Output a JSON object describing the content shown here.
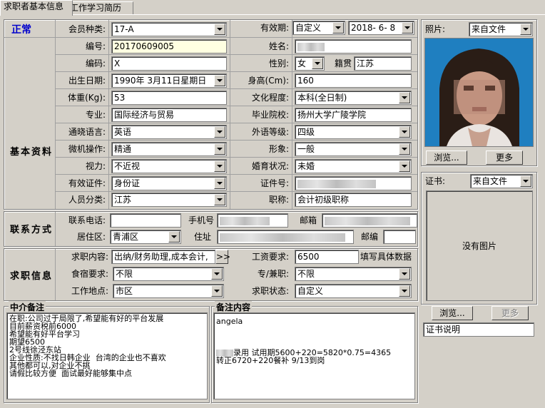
{
  "tabs": [
    "求职者基本信息",
    "工作学习简历"
  ],
  "status": "正常",
  "sections": {
    "basic": "基本资料",
    "contact": "联系方式",
    "job": "求职信息",
    "agent_notes": "中介备注",
    "notes": "备注内容"
  },
  "labels": {
    "member_type": "会员种类:",
    "validity": "有效期:",
    "number": "编号:",
    "name": "姓名:",
    "code": "编码:",
    "gender": "性别:",
    "native": "籍贯",
    "birth": "出生日期:",
    "height": "身高(Cm):",
    "weight": "体重(Kg):",
    "education": "文化程度:",
    "major": "专业:",
    "school": "毕业院校:",
    "language": "通晓语言:",
    "foreign_level": "外语等级:",
    "computer": "微机操作:",
    "image": "形象:",
    "vision": "视力:",
    "marital": "婚育状况:",
    "id_type": "有效证件:",
    "id_number": "证件号:",
    "person_class": "人员分类:",
    "title": "职称:",
    "phone": "联系电话:",
    "mobile": "手机号",
    "email": "邮箱",
    "district": "居住区:",
    "address": "住址",
    "postcode": "邮编",
    "job_content": "求职内容:",
    "salary": "工资要求:",
    "salary_hint": "填写具体数据",
    "lodging": "食宿要求:",
    "fulltime": "专/兼职:",
    "location": "工作地点:",
    "job_status": "求职状态:",
    "photo": "照片:",
    "certificate": "证书:"
  },
  "values": {
    "member_type": "17-A",
    "validity_type": "自定义",
    "validity_date": "2018- 6- 8",
    "number": "20170609005",
    "code": "X",
    "gender": "女",
    "native": "江苏",
    "birth": "1990年 3月11日星期日",
    "height": "160",
    "weight": "53",
    "education": "本科(全日制)",
    "major": "国际经济与贸易",
    "school": "扬州大学广陵学院",
    "language": "英语",
    "foreign_level": "四级",
    "computer": "精通",
    "image": "一般",
    "vision": "不近视",
    "marital": "未婚",
    "id_type": "身份证",
    "person_class": "江苏",
    "title": "会计初级职称",
    "district": "青浦区",
    "job_content": "出纳/财务助理,成本会计,",
    "salary": "6500",
    "lodging": "不限",
    "fulltime": "不限",
    "location": "市区",
    "job_status": "自定义",
    "photo_source": "来自文件",
    "cert_source": "来自文件"
  },
  "buttons": {
    "expand": ">>",
    "browse": "浏览...",
    "more": "更多",
    "browse2": "浏览...",
    "more2": "更多"
  },
  "no_image": "没有图片",
  "cert_desc": "证书说明",
  "agent_notes_text": "在职:公司过于局限了,希望能有好的平台发展\n目前薪资税前6000\n希望能有好平台学习\n期望6500\n2号线徐泾东站\n企业性质:不找日韩企业  台湾的企业也不喜欢\n其他都可以,对企业不挑\n请假比较方便  面试最好能够集中点",
  "notes_line1": "angela",
  "notes_line2_suffix": "录用 试用期5600+220=5820*0.75=4365",
  "notes_line3": "转正6720+220餐补 9/13到岗",
  "colors": {
    "status": "#0000cc",
    "face_bg": "#1f7fc0"
  }
}
